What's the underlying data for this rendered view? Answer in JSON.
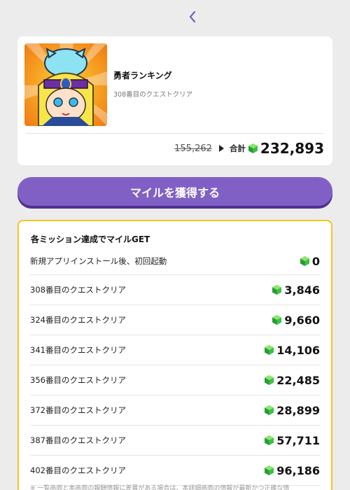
{
  "header": {
    "back_icon": "chevron-left-icon"
  },
  "app": {
    "title": "勇者ランキング",
    "subtitle": "308番目のクエストクリア",
    "old_price": "155,262",
    "total_label": "合計",
    "total_value": "232,893"
  },
  "earn_button": {
    "label": "マイルを獲得する"
  },
  "missions": {
    "title": "各ミッション達成でマイルGET",
    "items": [
      {
        "label": "新規アプリインストール後、初回起動",
        "value": "0"
      },
      {
        "label": "308番目のクエストクリア",
        "value": "3,846"
      },
      {
        "label": "324番目のクエストクリア",
        "value": "9,660"
      },
      {
        "label": "341番目のクエストクリア",
        "value": "14,106"
      },
      {
        "label": "356番目のクエストクリア",
        "value": "22,485"
      },
      {
        "label": "372番目のクエストクリア",
        "value": "28,899"
      },
      {
        "label": "387番目のクエストクリア",
        "value": "57,711"
      },
      {
        "label": "402番目のクエストクリア",
        "value": "96,186"
      }
    ],
    "disclaimer": "※ 一覧画面と本画面の報酬情報に差異がある場合は、本詳細画面の情報が最新かつ正確な情"
  },
  "colors": {
    "accent": "#8160c5",
    "accent_shadow": "#4f2f91",
    "border": "#f4c51f",
    "gem": "#3cc04a"
  }
}
